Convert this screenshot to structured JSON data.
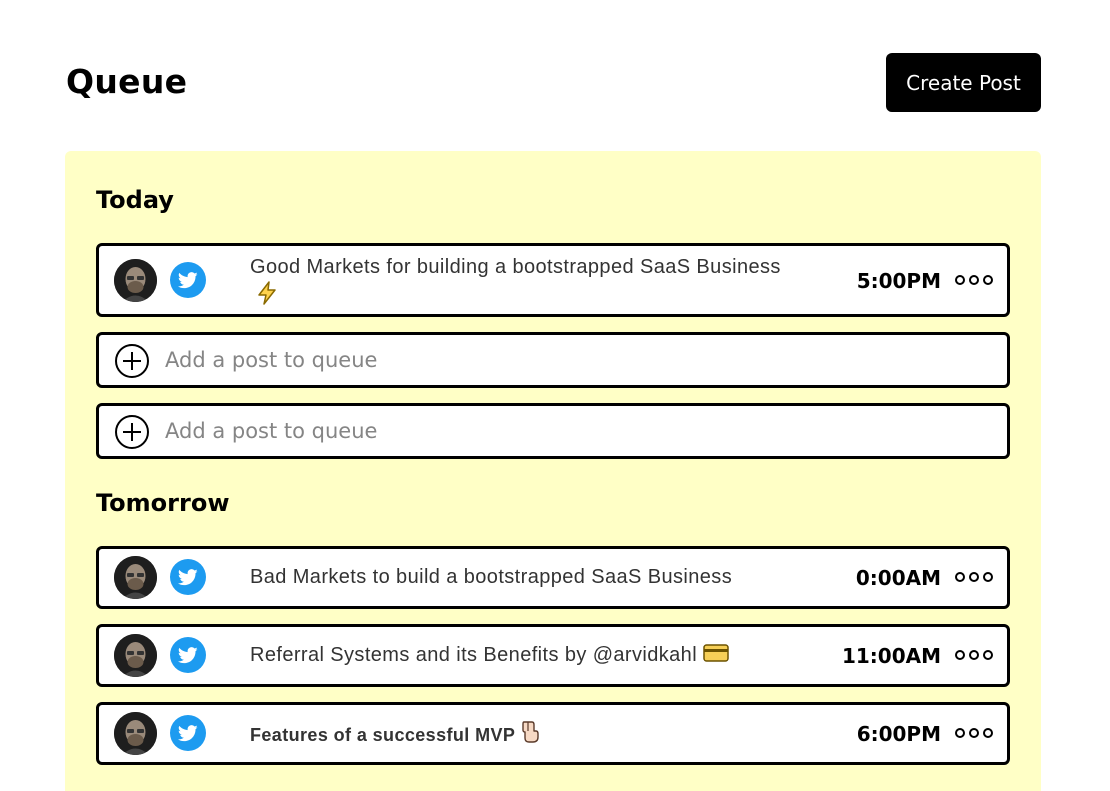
{
  "header": {
    "title": "Queue",
    "create_label": "Create Post"
  },
  "colors": {
    "panel_bg": "#ffffc6",
    "twitter_blue": "#1d9bf0",
    "button_bg": "#000000"
  },
  "today": {
    "heading": "Today",
    "posts": [
      {
        "text": "Good Markets for building a bootstrapped SaaS Business",
        "emoji_icon": "lightning-icon",
        "time": "5:00PM"
      }
    ],
    "add_slots": [
      {
        "label": "Add a post to queue"
      },
      {
        "label": "Add a post to queue"
      }
    ]
  },
  "tomorrow": {
    "heading": "Tomorrow",
    "posts": [
      {
        "text": "Bad Markets to build a bootstrapped SaaS Business",
        "emoji_icon": "",
        "time": "0:00AM"
      },
      {
        "text": "Referral Systems and its Benefits by @arvidkahl",
        "emoji_icon": "credit-card-icon",
        "time": "11:00AM"
      },
      {
        "text": "Features of a successful MVP",
        "emoji_icon": "pointing-down-hand-icon",
        "time": "6:00PM"
      }
    ]
  }
}
